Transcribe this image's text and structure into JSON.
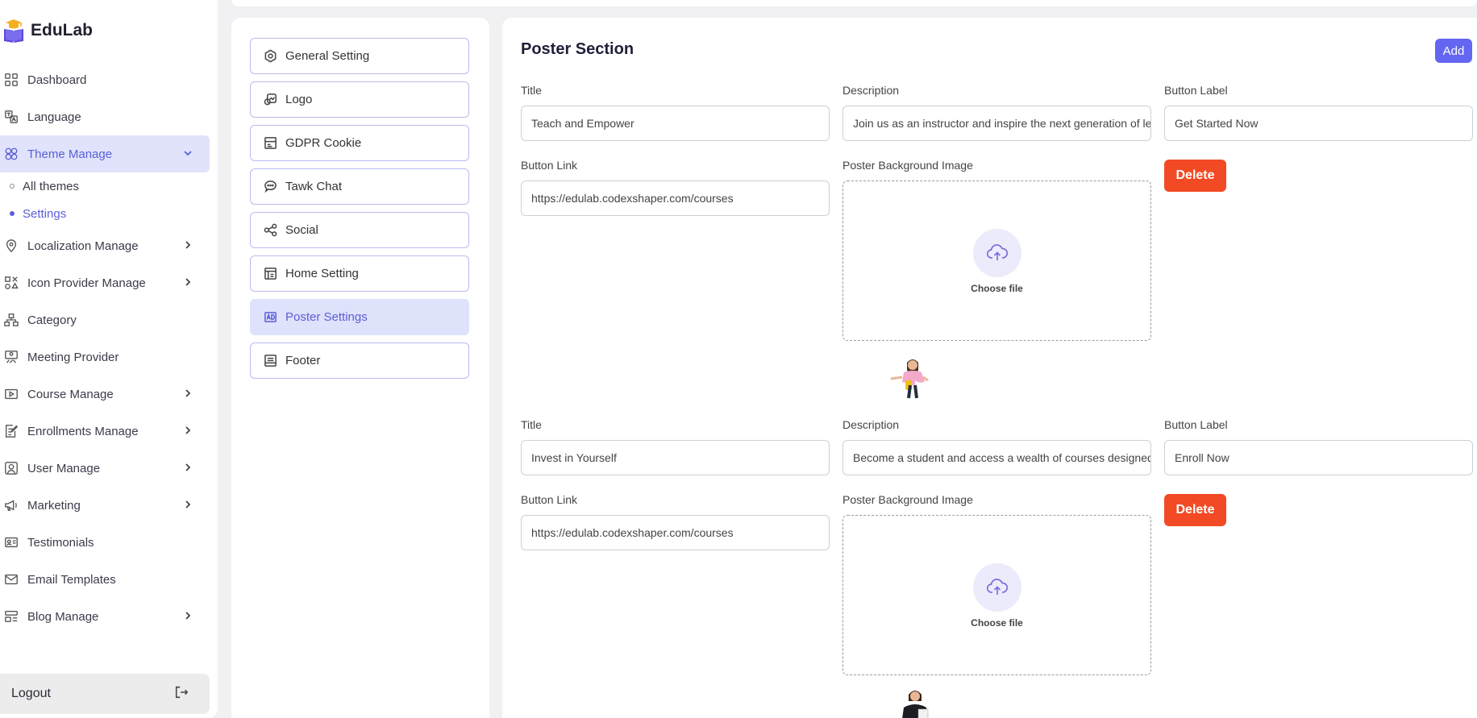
{
  "brand": {
    "name": "EduLab"
  },
  "sidebar": {
    "items": [
      {
        "label": "Dashboard",
        "icon": "dashboard-icon"
      },
      {
        "label": "Language",
        "icon": "language-icon"
      },
      {
        "label": "Theme Manage",
        "icon": "theme-icon",
        "active": true,
        "expanded": true
      },
      {
        "label": "Localization Manage",
        "icon": "location-icon",
        "has_children": true
      },
      {
        "label": "Icon Provider Manage",
        "icon": "shapes-icon",
        "has_children": true
      },
      {
        "label": "Category",
        "icon": "hierarchy-icon"
      },
      {
        "label": "Meeting Provider",
        "icon": "meeting-icon"
      },
      {
        "label": "Course Manage",
        "icon": "video-icon",
        "has_children": true
      },
      {
        "label": "Enrollments Manage",
        "icon": "edit-doc-icon",
        "has_children": true
      },
      {
        "label": "User Manage",
        "icon": "user-icon",
        "has_children": true
      },
      {
        "label": "Marketing",
        "icon": "megaphone-icon",
        "has_children": true
      },
      {
        "label": "Testimonials",
        "icon": "id-card-icon"
      },
      {
        "label": "Email Templates",
        "icon": "mail-icon"
      },
      {
        "label": "Blog Manage",
        "icon": "blog-icon",
        "has_children": true
      }
    ],
    "theme_sub": [
      {
        "label": "All themes"
      },
      {
        "label": "Settings",
        "active": true
      }
    ],
    "logout_label": "Logout"
  },
  "settings_menu": [
    {
      "label": "General Setting",
      "icon": "hexagon-gear-icon"
    },
    {
      "label": "Logo",
      "icon": "logo-icon"
    },
    {
      "label": "GDPR Cookie",
      "icon": "cookie-icon"
    },
    {
      "label": "Tawk Chat",
      "icon": "chat-icon"
    },
    {
      "label": "Social",
      "icon": "share-icon"
    },
    {
      "label": "Home Setting",
      "icon": "layout-icon"
    },
    {
      "label": "Poster Settings",
      "icon": "ad-icon",
      "active": true
    },
    {
      "label": "Footer",
      "icon": "footer-icon"
    }
  ],
  "poster": {
    "section_title": "Poster Section",
    "add_label": "Add",
    "labels": {
      "title": "Title",
      "description": "Description",
      "button_label": "Button Label",
      "button_link": "Button Link",
      "background": "Poster Background Image",
      "choose_file": "Choose file",
      "delete": "Delete"
    },
    "items": [
      {
        "title": "Teach and Empower",
        "description": "Join us as an instructor and inspire the next generation of learners",
        "button_label": "Get Started Now",
        "button_link": "https://edulab.codexshaper.com/courses"
      },
      {
        "title": "Invest in Yourself",
        "description": "Become a student and access a wealth of courses designed for you",
        "button_label": "Enroll Now",
        "button_link": "https://edulab.codexshaper.com/courses"
      }
    ]
  },
  "colors": {
    "accent": "#6366f1",
    "active_bg": "#dfe2fb",
    "delete": "#f24a24"
  }
}
